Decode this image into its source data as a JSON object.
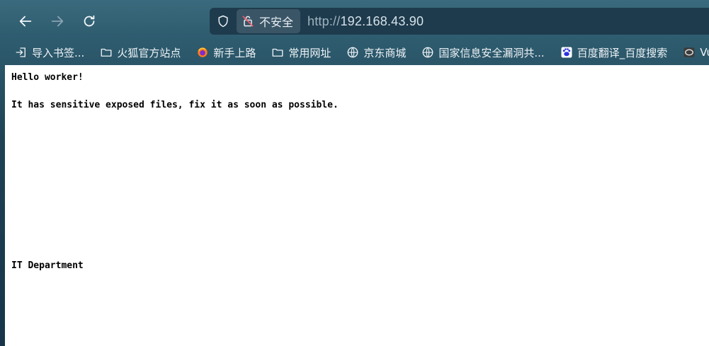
{
  "browser": {
    "url": {
      "scheme": "http://",
      "host": "192.168.43.90"
    },
    "security_label": "不安全",
    "bookmarks": [
      {
        "label": "导入书签...",
        "icon": "import-icon"
      },
      {
        "label": "火狐官方站点",
        "icon": "folder-icon"
      },
      {
        "label": "新手上路",
        "icon": "firefox-icon"
      },
      {
        "label": "常用网址",
        "icon": "folder-icon"
      },
      {
        "label": "京东商城",
        "icon": "globe-icon"
      },
      {
        "label": "国家信息安全漏洞共...",
        "icon": "globe-icon"
      },
      {
        "label": "百度翻译_百度搜索",
        "icon": "baidu-icon"
      },
      {
        "label": "Vulner",
        "icon": "vulnhub-icon"
      }
    ]
  },
  "page": {
    "greeting": "Hello worker!",
    "message": "It has sensitive exposed files, fix it as soon as possible.",
    "signature": "IT Department"
  },
  "colors": {
    "toolbar_bg": "#2f5d70",
    "urlbar_bg": "#1e3b4d",
    "page_bg": "#ffffff"
  }
}
